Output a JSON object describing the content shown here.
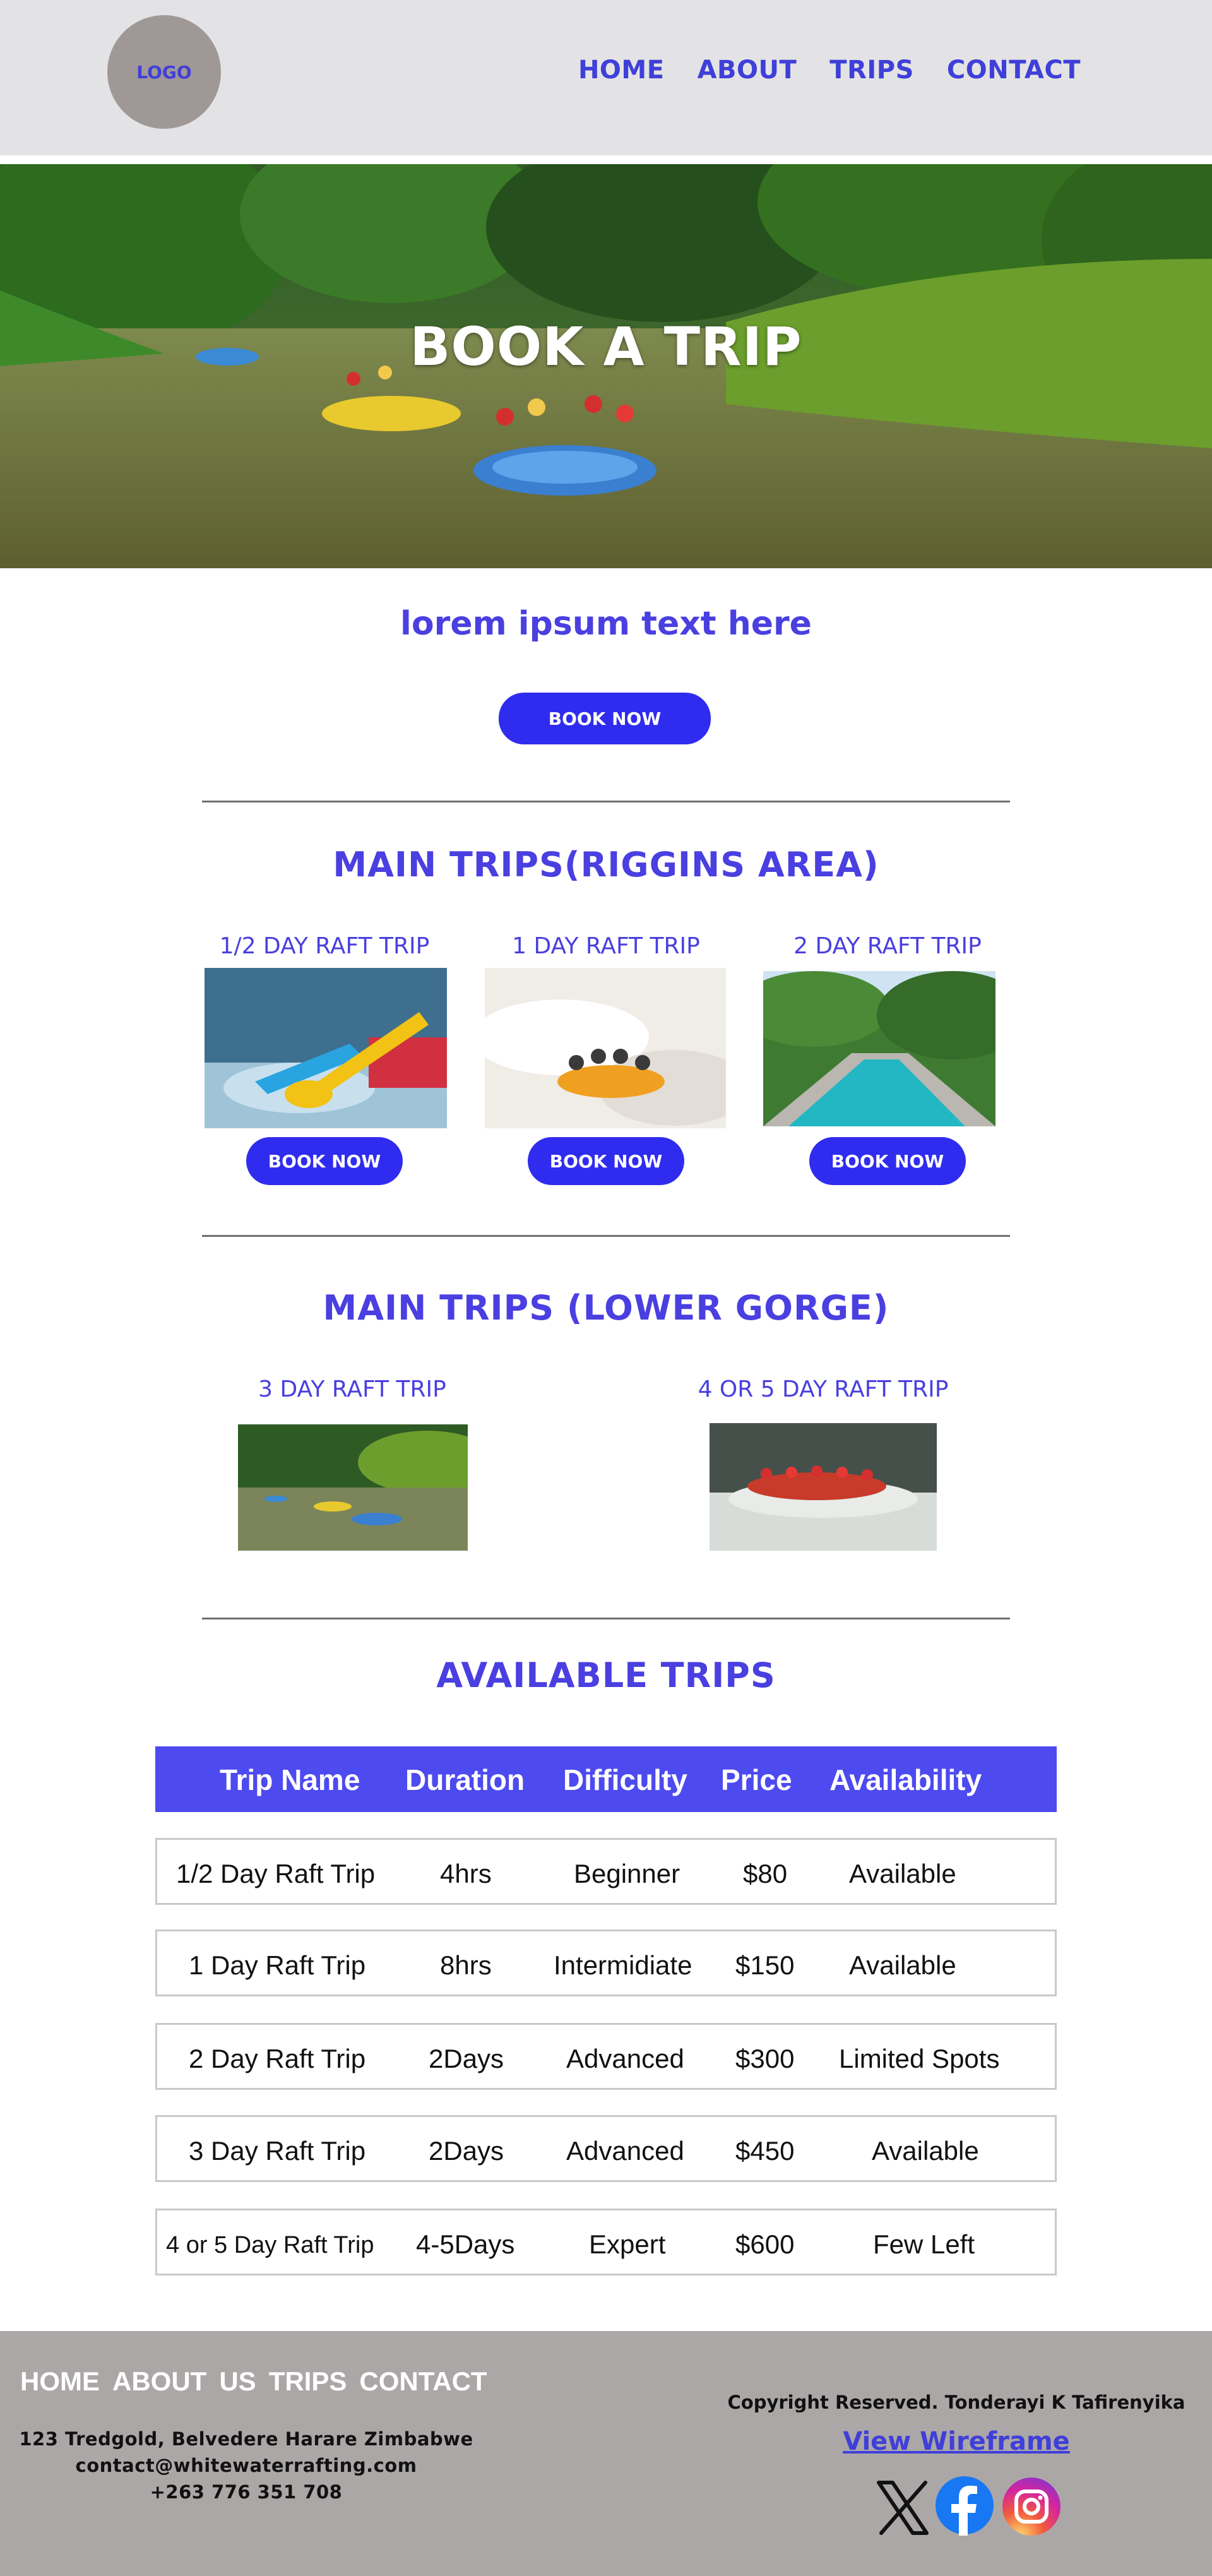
{
  "header": {
    "logo": "LOGO",
    "nav": [
      "HOME",
      "ABOUT",
      "TRIPS",
      "CONTACT"
    ]
  },
  "hero": {
    "title": "BOOK A TRIP"
  },
  "intro": {
    "tagline": "lorem ipsum text here",
    "button": "BOOK NOW"
  },
  "riggins": {
    "title": "MAIN TRIPS(RIGGINS AREA)",
    "trips": [
      {
        "label": "1/2 DAY RAFT TRIP",
        "button": "BOOK NOW"
      },
      {
        "label": "1 DAY RAFT TRIP",
        "button": "BOOK NOW"
      },
      {
        "label": "2 DAY RAFT TRIP",
        "button": "BOOK NOW"
      }
    ]
  },
  "gorge": {
    "title": "MAIN TRIPS (LOWER GORGE)",
    "trips": [
      {
        "label": "3 DAY RAFT TRIP"
      },
      {
        "label": "4 OR 5 DAY RAFT TRIP"
      }
    ]
  },
  "available": {
    "title": "AVAILABLE TRIPS",
    "headers": [
      "Trip Name",
      "Duration",
      "Difficulty",
      "Price",
      "Availability"
    ],
    "rows": [
      [
        "1/2 Day Raft Trip",
        "4hrs",
        "Beginner",
        "$80",
        "Available"
      ],
      [
        "1 Day Raft Trip",
        "8hrs",
        "Intermidiate",
        "$150",
        "Available"
      ],
      [
        "2 Day Raft Trip",
        "2Days",
        "Advanced",
        "$300",
        "Limited Spots"
      ],
      [
        "3 Day Raft Trip",
        "2Days",
        "Advanced",
        "$450",
        "Available"
      ],
      [
        "4 or 5 Day Raft Trip",
        "4-5Days",
        "Expert",
        "$600",
        "Few Left"
      ]
    ]
  },
  "footer": {
    "nav": [
      "HOME",
      "ABOUT",
      "US",
      "TRIPS",
      "CONTACT"
    ],
    "address": [
      "123 Tredgold, Belvedere Harare Zimbabwe",
      "contact@whitewaterrafting.com",
      "+263 776 351 708"
    ],
    "copyright": "Copyright Reserved. Tonderayi K Tafirenyika",
    "wireframe_link": "View Wireframe",
    "social": [
      "x-icon",
      "facebook-icon",
      "instagram-icon"
    ]
  },
  "colors": {
    "accent": "#4a3fe0",
    "button": "#2f2cef",
    "header_bg": "#e3e3e5",
    "footer_bg": "#aca7a7",
    "table_head": "#4d4aef"
  }
}
